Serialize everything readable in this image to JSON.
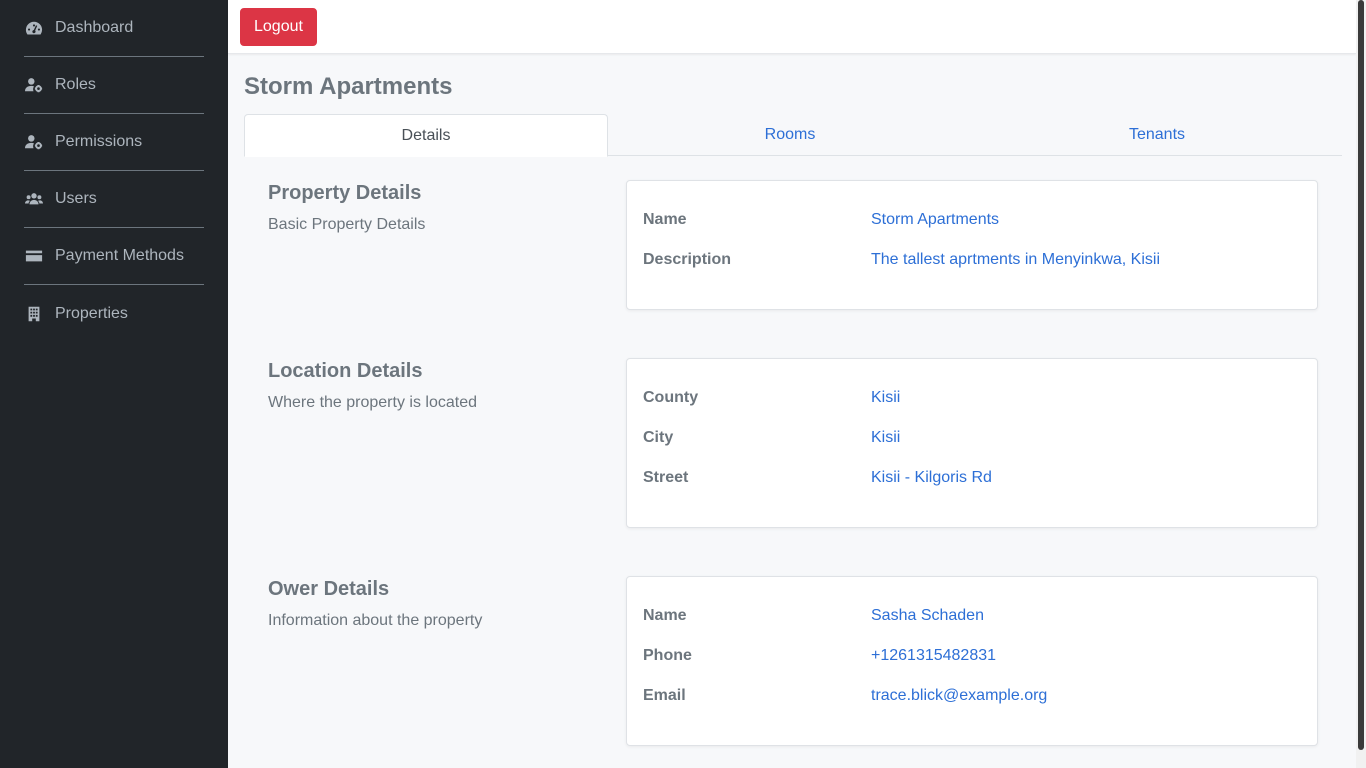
{
  "sidebar": {
    "items": [
      {
        "label": "Dashboard",
        "icon": "dashboard-icon"
      },
      {
        "label": "Roles",
        "icon": "user-gear-icon"
      },
      {
        "label": "Permissions",
        "icon": "user-gear-icon"
      },
      {
        "label": "Users",
        "icon": "users-icon"
      },
      {
        "label": "Payment Methods",
        "icon": "credit-card-icon"
      },
      {
        "label": "Properties",
        "icon": "building-icon"
      }
    ]
  },
  "topbar": {
    "logout_label": "Logout"
  },
  "page": {
    "title": "Storm Apartments"
  },
  "tabs": [
    {
      "label": "Details",
      "active": true
    },
    {
      "label": "Rooms",
      "active": false
    },
    {
      "label": "Tenants",
      "active": false
    }
  ],
  "property": {
    "title": "Property Details",
    "subtitle": "Basic Property Details",
    "rows": [
      {
        "label": "Name",
        "value": "Storm Apartments"
      },
      {
        "label": "Description",
        "value": "The tallest aprtments in Menyinkwa, Kisii"
      }
    ]
  },
  "location": {
    "title": "Location Details",
    "subtitle": "Where the property is located",
    "rows": [
      {
        "label": "County",
        "value": "Kisii"
      },
      {
        "label": "City",
        "value": "Kisii"
      },
      {
        "label": "Street",
        "value": "Kisii - Kilgoris Rd"
      }
    ]
  },
  "owner": {
    "title": "Ower Details",
    "subtitle": "Information about the property",
    "rows": [
      {
        "label": "Name",
        "value": "Sasha Schaden"
      },
      {
        "label": "Phone",
        "value": "+1261315482831"
      },
      {
        "label": "Email",
        "value": "trace.blick@example.org"
      }
    ]
  },
  "colors": {
    "sidebar_bg": "#212529",
    "logout": "#dc3545",
    "link": "#2d6fd6",
    "muted": "#6c757d"
  }
}
